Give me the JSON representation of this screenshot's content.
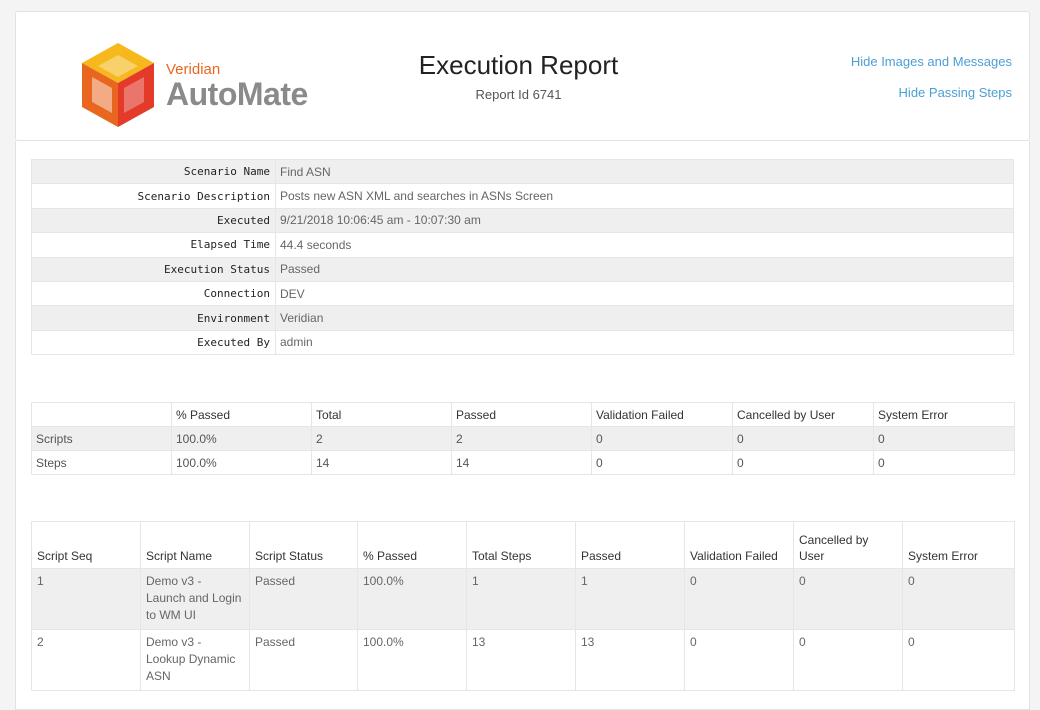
{
  "header": {
    "logo_small": "Veridian",
    "logo_big": "AutoMate",
    "title": "Execution Report",
    "report_id": "Report Id 6741",
    "link_hide_images": "Hide Images and Messages",
    "link_hide_passing": "Hide Passing Steps"
  },
  "colors": {
    "accent_link": "#4a9fd5",
    "logo_orange": "#e8661f",
    "logo_yellow": "#f6b81c",
    "logo_red": "#e33a2a"
  },
  "details": [
    {
      "label": "Scenario Name",
      "value": "Find ASN"
    },
    {
      "label": "Scenario Description",
      "value": "Posts new ASN XML and searches in ASNs Screen"
    },
    {
      "label": "Executed",
      "value": "9/21/2018 10:06:45 am - 10:07:30 am"
    },
    {
      "label": "Elapsed Time",
      "value": "44.4 seconds"
    },
    {
      "label": "Execution Status",
      "value": "Passed"
    },
    {
      "label": "Connection",
      "value": "DEV"
    },
    {
      "label": "Environment",
      "value": "Veridian"
    },
    {
      "label": "Executed By",
      "value": "admin"
    }
  ],
  "summary": {
    "headers": [
      "",
      "% Passed",
      "Total",
      "Passed",
      "Validation Failed",
      "Cancelled by User",
      "System Error"
    ],
    "rows": [
      [
        "Scripts",
        "100.0%",
        "2",
        "2",
        "0",
        "0",
        "0"
      ],
      [
        "Steps",
        "100.0%",
        "14",
        "14",
        "0",
        "0",
        "0"
      ]
    ]
  },
  "scripts": {
    "headers": [
      "Script Seq",
      "Script Name",
      "Script Status",
      "% Passed",
      "Total Steps",
      "Passed",
      "Validation Failed",
      "Cancelled by User",
      "System Error"
    ],
    "rows": [
      [
        "1",
        "Demo v3 - Launch and Login to WM UI",
        "Passed",
        "100.0%",
        "1",
        "1",
        "0",
        "0",
        "0"
      ],
      [
        "2",
        "Demo v3 - Lookup Dynamic ASN",
        "Passed",
        "100.0%",
        "13",
        "13",
        "0",
        "0",
        "0"
      ]
    ]
  }
}
